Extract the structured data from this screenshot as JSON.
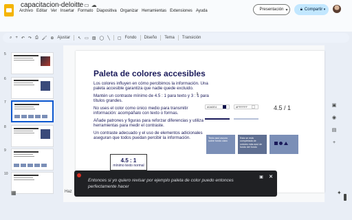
{
  "app": {
    "doc_title": "capacitacion-deloitte",
    "menu": [
      "Archivo",
      "Editar",
      "Ver",
      "Insertar",
      "Formato",
      "Diapositiva",
      "Organizar",
      "Herramientas",
      "Extensiones",
      "Ayuda"
    ],
    "present_label": "Presentación",
    "share_label": "Compartir"
  },
  "toolbar": {
    "zoom_label": "Ajustar",
    "fondo": "Fondo",
    "diseno": "Diseño",
    "tema": "Tema",
    "transicion": "Transición"
  },
  "thumbnails": [
    {
      "num": "5"
    },
    {
      "num": "6"
    },
    {
      "num": "7"
    },
    {
      "num": "8"
    },
    {
      "num": "9"
    },
    {
      "num": "10"
    }
  ],
  "slide": {
    "title": "Paleta de colores accesibles",
    "paragraphs": [
      "Los colores influyen en cómo percibimos la información. Una paleta accesible garantiza que nadie quede excluido.",
      "Mantén un contraste mínimo de 4.5 : 1 para texto y 3 : 1 para títulos grandes.",
      "No uses el color como único medio para transmitir información: acompáñalo con texto o formas.",
      "Añade patrones y figuras para reforzar diferencias y utiliza herramientas para medir el contraste.",
      "Un contraste adecuado y el uso de elementos adicionales aseguran que todos puedan percibir la información."
    ],
    "ratio_value": "4.5 : 1",
    "ratio_label": "mínimo texto normal",
    "contrast_ratio": "4.5 / 1",
    "field1": "#0A0E4",
    "field2": "#FFFFFF",
    "card2_text": "Esta se está completada de colores más azul de fondo del fondo",
    "card1_text": "Texto azul oscuro sobre fondo claro"
  },
  "bottom": {
    "notes_hint": "Haz"
  },
  "caption": {
    "text": "Entonces si yo quiero revisar por ejemplo paleta de color puedo entonces perfectamente hacer"
  },
  "colors": {
    "accent": "#0b57d0",
    "title_text": "#1a1a5a",
    "card": "#7b8fb7",
    "share_bg": "#c2e7ff"
  }
}
